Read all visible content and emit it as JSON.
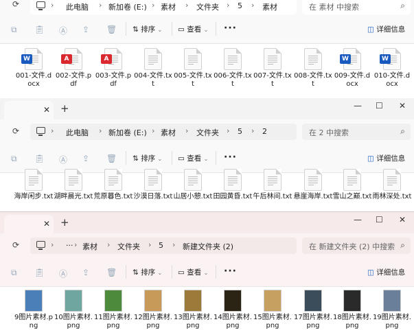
{
  "window1": {
    "breadcrumb": [
      "此电脑",
      "新加卷 (E:)",
      "素材",
      "文件夹",
      "5",
      "素材"
    ],
    "search_placeholder": "在 素材 中搜索",
    "toolbar": {
      "sort": "排序",
      "view": "查看",
      "details": "详细信息"
    },
    "files": [
      {
        "name": "001-文件.docx",
        "icon": "word-file-icon",
        "type": "w"
      },
      {
        "name": "002-文件.pdf",
        "icon": "pdf-file-icon",
        "type": "p"
      },
      {
        "name": "003-文件.pdf",
        "icon": "pdf-file-icon",
        "type": "p"
      },
      {
        "name": "004-文件.txt",
        "icon": "text-file-icon",
        "type": "t"
      },
      {
        "name": "005-文件.txt",
        "icon": "text-file-icon",
        "type": "t"
      },
      {
        "name": "006-文件.txt",
        "icon": "text-file-icon",
        "type": "t"
      },
      {
        "name": "007-文件.txt",
        "icon": "text-file-icon",
        "type": "t"
      },
      {
        "name": "008-文件.txt",
        "icon": "text-file-icon",
        "type": "t"
      },
      {
        "name": "009-文件.docx",
        "icon": "word-file-icon",
        "type": "w"
      },
      {
        "name": "010-文件.docx",
        "icon": "word-file-icon",
        "type": "w"
      }
    ]
  },
  "window2": {
    "breadcrumb": [
      "此电脑",
      "新加卷 (E:)",
      "素材",
      "文件夹",
      "5",
      "2"
    ],
    "search_placeholder": "在 2 中搜索",
    "toolbar": {
      "sort": "排序",
      "view": "查看",
      "details": "详细信息"
    },
    "files": [
      {
        "name": "海岸闲步.txt"
      },
      {
        "name": "湖畔晨光.txt"
      },
      {
        "name": "荒原暮色.txt"
      },
      {
        "name": "沙漠日落.txt"
      },
      {
        "name": "山居小憩.txt"
      },
      {
        "name": "田园黄昏.txt"
      },
      {
        "name": "午后林间.txt"
      },
      {
        "name": "悬崖海岸.txt"
      },
      {
        "name": "雪山之巅.txt"
      },
      {
        "name": "雨林深处.txt"
      }
    ]
  },
  "window3": {
    "breadcrumb": [
      "···",
      "素材",
      "文件夹",
      "5",
      "新建文件夹 (2)"
    ],
    "search_placeholder": "在 新建文件夹 (2) 中搜索",
    "toolbar": {
      "sort": "排序",
      "view": "查看",
      "details": "详细信息"
    },
    "files": [
      {
        "name": "9图片素材.png",
        "color": "#4b7fb8"
      },
      {
        "name": "10图片素材.png",
        "color": "#6fa6a0"
      },
      {
        "name": "11图片素材.png",
        "color": "#4e8a3c"
      },
      {
        "name": "12图片素材.png",
        "color": "#c89a5a"
      },
      {
        "name": "13图片素材.png",
        "color": "#9b7a3a"
      },
      {
        "name": "14图片素材.png",
        "color": "#2b2414"
      },
      {
        "name": "15图片素材.png",
        "color": "#c6a060"
      },
      {
        "name": "17图片素材.png",
        "color": "#3b4d5a"
      },
      {
        "name": "18图片素材.png",
        "color": "#2a2a2a"
      },
      {
        "name": "19图片素材.png",
        "color": "#6a7f9a"
      }
    ]
  }
}
